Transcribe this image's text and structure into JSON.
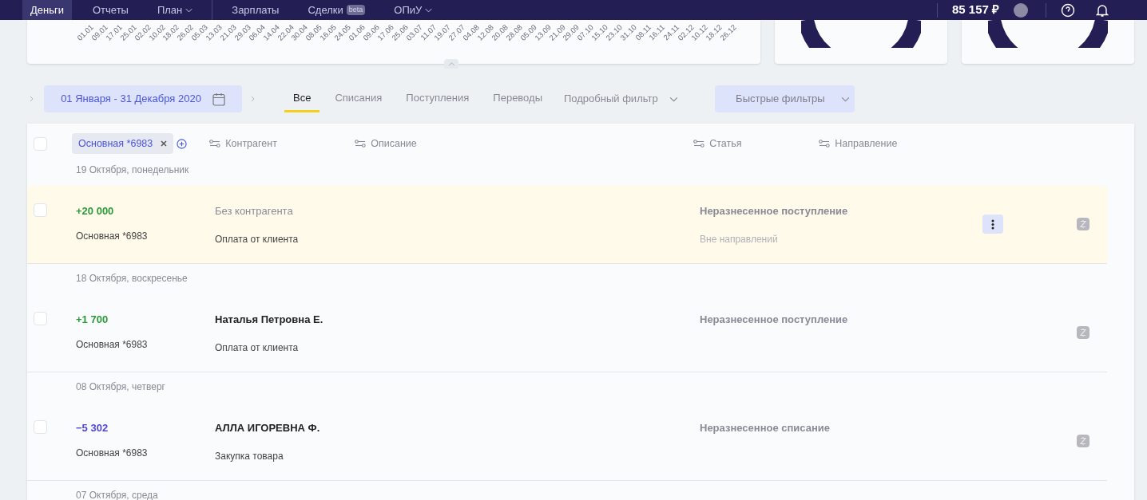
{
  "nav": {
    "items": [
      {
        "label": "Деньги",
        "selected": true,
        "dropdown": false
      },
      {
        "label": "Отчеты",
        "selected": false,
        "dropdown": false
      },
      {
        "label": "План",
        "selected": false,
        "dropdown": true
      },
      {
        "label": "Зарплаты",
        "selected": false,
        "dropdown": false,
        "group_start": true
      },
      {
        "label": "Сделки",
        "selected": false,
        "dropdown": false,
        "badge": "beta"
      },
      {
        "label": "ОПиУ",
        "selected": false,
        "dropdown": true
      }
    ],
    "balance": "85 157 ₽"
  },
  "chart_card": {
    "date_labels": [
      "01.01",
      "09.01",
      "17.01",
      "25.01",
      "02.02",
      "10.02",
      "18.02",
      "26.02",
      "05.03",
      "13.03",
      "21.03",
      "29.03",
      "06.04",
      "14.04",
      "22.04",
      "30.04",
      "08.05",
      "16.05",
      "24.05",
      "01.06",
      "09.06",
      "17.06",
      "25.06",
      "03.07",
      "11.07",
      "19.07",
      "27.07",
      "04.08",
      "12.08",
      "20.08",
      "28.08",
      "05.09",
      "13.09",
      "21.09",
      "29.09",
      "07.10",
      "15.10",
      "23.10",
      "31.10",
      "08.11",
      "16.11",
      "24.11",
      "02.12",
      "10.12",
      "18.12",
      "26.12"
    ]
  },
  "period": "01 Января - 31 Декабря 2020",
  "tabs": [
    {
      "label": "Все",
      "selected": true
    },
    {
      "label": "Списания",
      "selected": false
    },
    {
      "label": "Поступления",
      "selected": false
    },
    {
      "label": "Переводы",
      "selected": false
    }
  ],
  "detailed_filter": "Подробный фильтр",
  "quick_filters": "Быстрые фильтры",
  "table": {
    "select_all_checked": false,
    "account_chip": "Основная *6983",
    "columns": [
      "Контрагент",
      "Описание",
      "Статья",
      "Направление"
    ],
    "groups": [
      {
        "date": "19 Октября, понедельник",
        "rows": [
          {
            "amount": "+20 000",
            "kind": "income",
            "account": "Основная *6983",
            "counterparty": "Без контрагента",
            "counterparty_missing": true,
            "description": "Оплата от клиента",
            "category": "Неразнесенное поступление",
            "direction": "Вне направлений",
            "highlighted": true,
            "checked": false
          }
        ]
      },
      {
        "date": "18 Октября, воскресенье",
        "rows": [
          {
            "amount": "+1 700",
            "kind": "income",
            "account": "Основная *6983",
            "counterparty": "Наталья Петровна Е.",
            "counterparty_missing": false,
            "description": "Оплата от клиента",
            "category": "Неразнесенное поступление",
            "highlighted": false,
            "checked": false
          }
        ]
      },
      {
        "date": "08 Октября, четверг",
        "rows": [
          {
            "amount": "−5 302",
            "kind": "expense",
            "account": "Основная *6983",
            "counterparty": "АЛЛА ИГОРЕВНА Ф.",
            "counterparty_missing": false,
            "description": "Закупка товара",
            "category": "Неразнесенное списание",
            "highlighted": false,
            "checked": false
          }
        ]
      },
      {
        "date": "07 Октября, среда"
      }
    ]
  }
}
